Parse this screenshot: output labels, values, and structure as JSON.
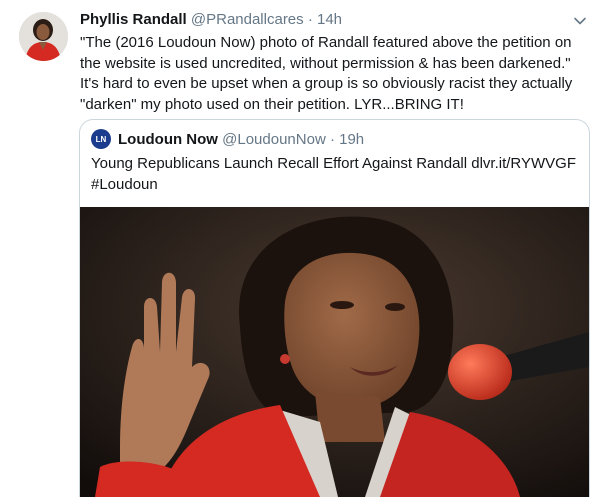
{
  "tweet": {
    "author_name": "Phyllis Randall",
    "author_handle": "@PRandallcares",
    "separator": "·",
    "time": "14h",
    "text": "\"The (2016 Loudoun Now) photo of Randall featured above the petition on the website is used uncredited, without permission & has been darkened.\" It's hard to even be upset when a group is so obviously racist they actually \"darken\" my photo used on their petition. LYR...BRING IT!",
    "menu_icon": "chevron-down-icon",
    "avatar_icon": "profile-photo"
  },
  "quoted": {
    "logo_text": "LN",
    "author_name": "Loudoun Now",
    "author_handle": "@LoudounNow",
    "separator": "·",
    "time": "19h",
    "text": "Young Republicans Launch Recall Effort Against Randall dlvr.it/RYWVGF #Loudoun",
    "media_icon": "photo-woman-taking-oath-at-microphone"
  },
  "colors": {
    "text_primary": "#14171a",
    "text_secondary": "#657786",
    "border": "#ccd6dd",
    "quote_logo": "#1b3c8c",
    "jacket_red": "#d42a22",
    "mic_red": "#e8402c"
  }
}
